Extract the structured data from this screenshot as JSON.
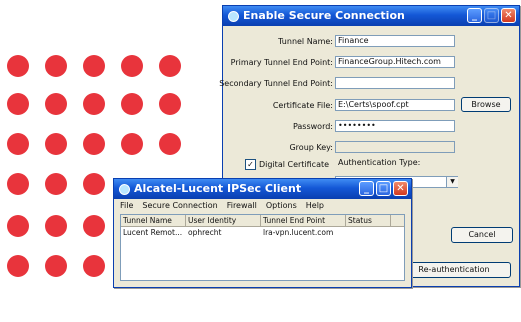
{
  "colors": {
    "dot": "#e8343c",
    "titlebar": "#1457d6",
    "window_bg": "#ece9d8"
  },
  "secure_dialog": {
    "title": "Enable Secure Connection",
    "fields": [
      {
        "label": "Tunnel Name:",
        "value": "Finance"
      },
      {
        "label": "Primary Tunnel End Point:",
        "value": "FinanceGroup.Hitech.com"
      },
      {
        "label": "Secondary Tunnel End Point:",
        "value": ""
      },
      {
        "label": "Certificate File:",
        "value": "E:\\Certs\\spoof.cpt"
      },
      {
        "label": "Password:",
        "value": "••••••••"
      },
      {
        "label": "Group Key:",
        "value": ""
      }
    ],
    "browse_label": "Browse",
    "digital_certificate_label": "Digital Certificate",
    "digital_certificate_checked": true,
    "auth_type_label": "Authentication Type:",
    "auth_type_value": "",
    "cancel_label": "Cancel",
    "reauth_label": "Re-authentication"
  },
  "client_window": {
    "title": "Alcatel-Lucent IPSec Client",
    "menu": [
      "File",
      "Secure Connection",
      "Firewall",
      "Options",
      "Help"
    ],
    "columns": [
      "Tunnel Name",
      "User Identity",
      "Tunnel End Point",
      "Status"
    ],
    "rows": [
      {
        "tunnel_name": "Lucent Remot...",
        "user_identity": "ophrecht",
        "end_point": "lra-vpn.lucent.com",
        "status": ""
      }
    ]
  }
}
